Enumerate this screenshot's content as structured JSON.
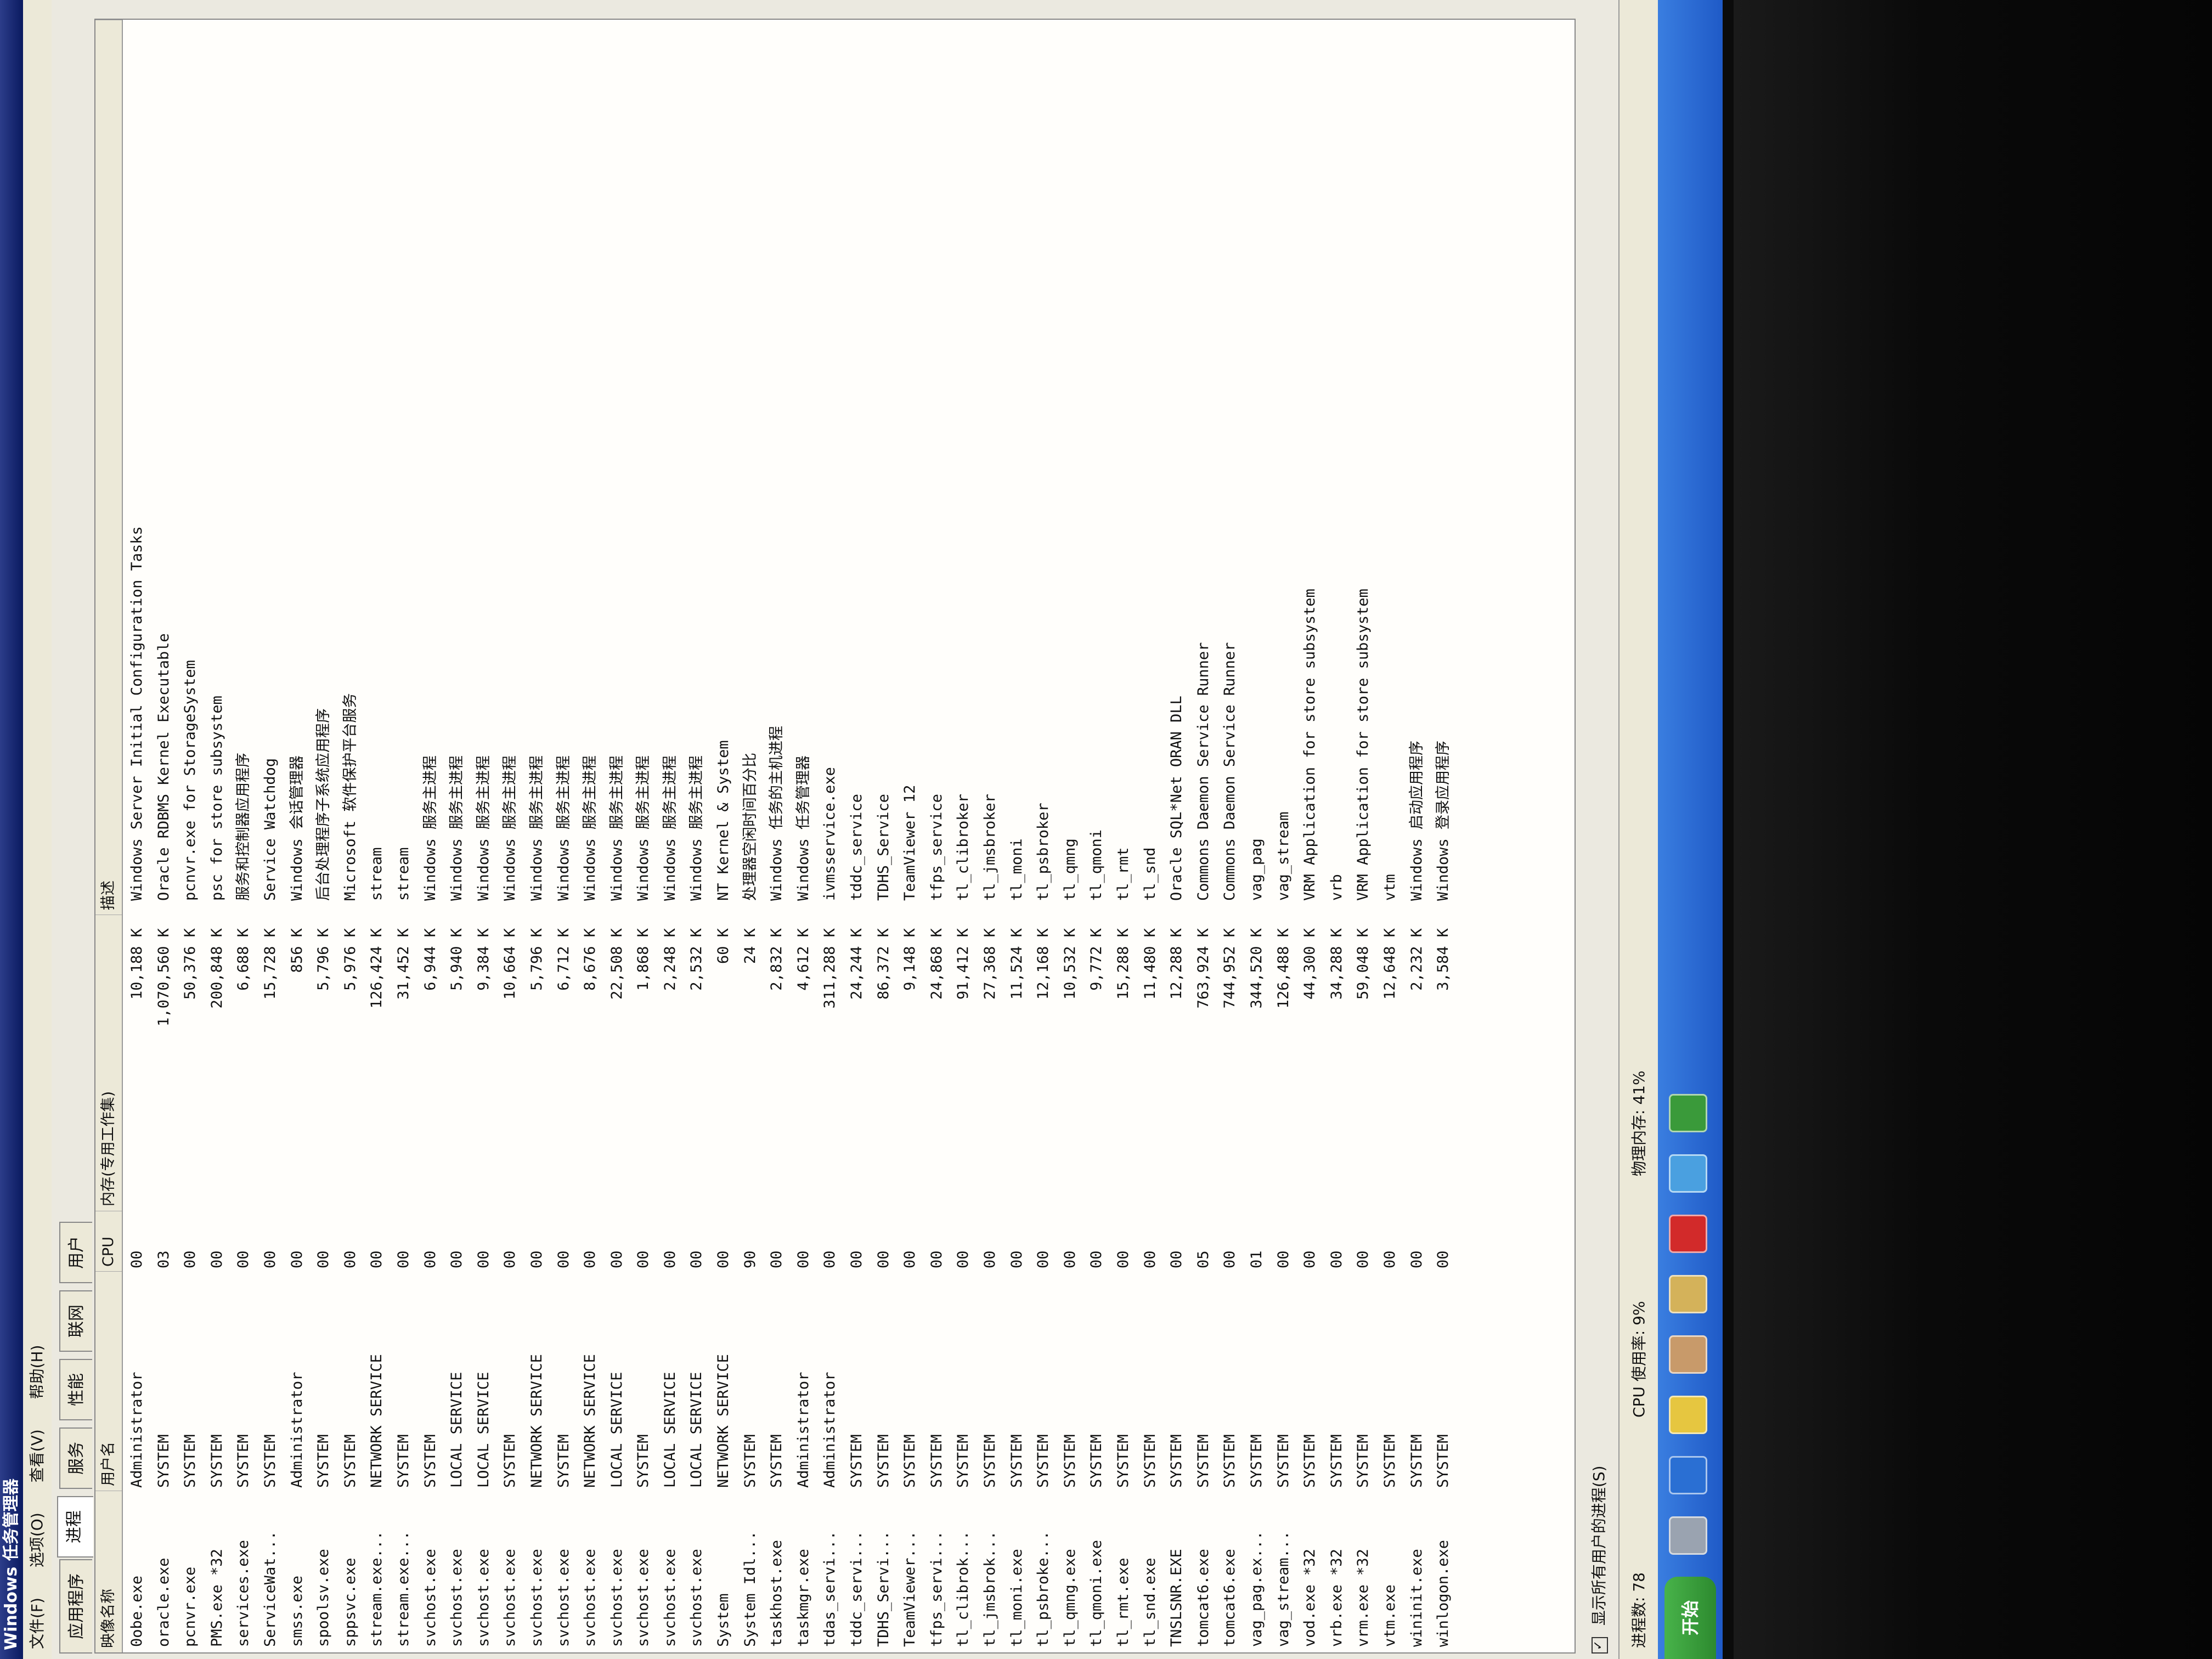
{
  "window": {
    "title": "Windows 任务管理器",
    "menu": [
      "文件(F)",
      "选项(O)",
      "查看(V)",
      "帮助(H)"
    ],
    "tabs": [
      "应用程序",
      "进程",
      "服务",
      "性能",
      "联网",
      "用户"
    ],
    "active_tab": "进程"
  },
  "columns": {
    "name": "映像名称",
    "user": "用户名",
    "cpu": "CPU",
    "mem": "内存(专用工作集)",
    "desc": "描述"
  },
  "processes": [
    {
      "name": "0obe.exe",
      "user": "Administrator",
      "cpu": "00",
      "mem": "10,188 K",
      "desc": "Windows Server Initial Configuration Tasks"
    },
    {
      "name": "oracle.exe",
      "user": "SYSTEM",
      "cpu": "03",
      "mem": "1,070,560 K",
      "desc": "Oracle RDBMS Kernel Executable"
    },
    {
      "name": "pcnvr.exe",
      "user": "SYSTEM",
      "cpu": "00",
      "mem": "50,376 K",
      "desc": "pcnvr.exe for StorageSystem"
    },
    {
      "name": "PMS.exe *32",
      "user": "SYSTEM",
      "cpu": "00",
      "mem": "200,848 K",
      "desc": "psc for store subsystem"
    },
    {
      "name": "services.exe",
      "user": "SYSTEM",
      "cpu": "00",
      "mem": "6,688 K",
      "desc": "服务和控制器应用程序"
    },
    {
      "name": "ServiceWat...",
      "user": "SYSTEM",
      "cpu": "00",
      "mem": "15,728 K",
      "desc": "Service Watchdog"
    },
    {
      "name": "smss.exe",
      "user": "Administrator",
      "cpu": "00",
      "mem": "856 K",
      "desc": "Windows 会话管理器"
    },
    {
      "name": "spoolsv.exe",
      "user": "SYSTEM",
      "cpu": "00",
      "mem": "5,796 K",
      "desc": "后台处理程序子系统应用程序"
    },
    {
      "name": "sppsvc.exe",
      "user": "SYSTEM",
      "cpu": "00",
      "mem": "5,976 K",
      "desc": "Microsoft 软件保护平台服务"
    },
    {
      "name": "stream.exe...",
      "user": "NETWORK SERVICE",
      "cpu": "00",
      "mem": "126,424 K",
      "desc": "stream"
    },
    {
      "name": "stream.exe...",
      "user": "SYSTEM",
      "cpu": "00",
      "mem": "31,452 K",
      "desc": "stream"
    },
    {
      "name": "svchost.exe",
      "user": "SYSTEM",
      "cpu": "00",
      "mem": "6,944 K",
      "desc": "Windows 服务主进程"
    },
    {
      "name": "svchost.exe",
      "user": "LOCAL SERVICE",
      "cpu": "00",
      "mem": "5,940 K",
      "desc": "Windows 服务主进程"
    },
    {
      "name": "svchost.exe",
      "user": "LOCAL SERVICE",
      "cpu": "00",
      "mem": "9,384 K",
      "desc": "Windows 服务主进程"
    },
    {
      "name": "svchost.exe",
      "user": "SYSTEM",
      "cpu": "00",
      "mem": "10,664 K",
      "desc": "Windows 服务主进程"
    },
    {
      "name": "svchost.exe",
      "user": "NETWORK SERVICE",
      "cpu": "00",
      "mem": "5,796 K",
      "desc": "Windows 服务主进程"
    },
    {
      "name": "svchost.exe",
      "user": "SYSTEM",
      "cpu": "00",
      "mem": "6,712 K",
      "desc": "Windows 服务主进程"
    },
    {
      "name": "svchost.exe",
      "user": "NETWORK SERVICE",
      "cpu": "00",
      "mem": "8,676 K",
      "desc": "Windows 服务主进程"
    },
    {
      "name": "svchost.exe",
      "user": "LOCAL SERVICE",
      "cpu": "00",
      "mem": "22,508 K",
      "desc": "Windows 服务主进程"
    },
    {
      "name": "svchost.exe",
      "user": "SYSTEM",
      "cpu": "00",
      "mem": "1,868 K",
      "desc": "Windows 服务主进程"
    },
    {
      "name": "svchost.exe",
      "user": "LOCAL SERVICE",
      "cpu": "00",
      "mem": "2,248 K",
      "desc": "Windows 服务主进程"
    },
    {
      "name": "svchost.exe",
      "user": "LOCAL SERVICE",
      "cpu": "00",
      "mem": "2,532 K",
      "desc": "Windows 服务主进程"
    },
    {
      "name": "System",
      "user": "NETWORK SERVICE",
      "cpu": "00",
      "mem": "60 K",
      "desc": "NT Kernel & System"
    },
    {
      "name": "System Idl...",
      "user": "SYSTEM",
      "cpu": "90",
      "mem": "24 K",
      "desc": "处理器空闲时间百分比"
    },
    {
      "name": "taskhost.exe",
      "user": "SYSTEM",
      "cpu": "00",
      "mem": "2,832 K",
      "desc": "Windows 任务的主机进程"
    },
    {
      "name": "taskmgr.exe",
      "user": "Administrator",
      "cpu": "00",
      "mem": "4,612 K",
      "desc": "Windows 任务管理器"
    },
    {
      "name": "tdas_servi...",
      "user": "Administrator",
      "cpu": "00",
      "mem": "311,288 K",
      "desc": "ivmsservice.exe"
    },
    {
      "name": "tddc_servi...",
      "user": "SYSTEM",
      "cpu": "00",
      "mem": "24,244 K",
      "desc": "tddc_service"
    },
    {
      "name": "TDHS_Servi...",
      "user": "SYSTEM",
      "cpu": "00",
      "mem": "86,372 K",
      "desc": "TDHS_Service"
    },
    {
      "name": "TeamViewer...",
      "user": "SYSTEM",
      "cpu": "00",
      "mem": "9,148 K",
      "desc": "TeamViewer 12"
    },
    {
      "name": "tfps_servi...",
      "user": "SYSTEM",
      "cpu": "00",
      "mem": "24,868 K",
      "desc": "tfps_service"
    },
    {
      "name": "tl_clibrok...",
      "user": "SYSTEM",
      "cpu": "00",
      "mem": "91,412 K",
      "desc": "tl_clibroker"
    },
    {
      "name": "tl_jmsbrok...",
      "user": "SYSTEM",
      "cpu": "00",
      "mem": "27,368 K",
      "desc": "tl_jmsbroker"
    },
    {
      "name": "tl_moni.exe",
      "user": "SYSTEM",
      "cpu": "00",
      "mem": "11,524 K",
      "desc": "tl_moni"
    },
    {
      "name": "tl_psbroke...",
      "user": "SYSTEM",
      "cpu": "00",
      "mem": "12,168 K",
      "desc": "tl_psbroker"
    },
    {
      "name": "tl_qmng.exe",
      "user": "SYSTEM",
      "cpu": "00",
      "mem": "10,532 K",
      "desc": "tl_qmng"
    },
    {
      "name": "tl_qmoni.exe",
      "user": "SYSTEM",
      "cpu": "00",
      "mem": "9,772 K",
      "desc": "tl_qmoni"
    },
    {
      "name": "tl_rmt.exe",
      "user": "SYSTEM",
      "cpu": "00",
      "mem": "15,288 K",
      "desc": "tl_rmt"
    },
    {
      "name": "tl_snd.exe",
      "user": "SYSTEM",
      "cpu": "00",
      "mem": "11,480 K",
      "desc": "tl_snd"
    },
    {
      "name": "TNSLSNR.EXE",
      "user": "SYSTEM",
      "cpu": "00",
      "mem": "12,288 K",
      "desc": "Oracle SQL*Net ORAN DLL"
    },
    {
      "name": "tomcat6.exe",
      "user": "SYSTEM",
      "cpu": "05",
      "mem": "763,924 K",
      "desc": "Commons Daemon Service Runner"
    },
    {
      "name": "tomcat6.exe",
      "user": "SYSTEM",
      "cpu": "00",
      "mem": "744,952 K",
      "desc": "Commons Daemon Service Runner"
    },
    {
      "name": "vag_pag.ex...",
      "user": "SYSTEM",
      "cpu": "01",
      "mem": "344,520 K",
      "desc": "vag_pag"
    },
    {
      "name": "vag_stream...",
      "user": "SYSTEM",
      "cpu": "00",
      "mem": "126,488 K",
      "desc": "vag_stream"
    },
    {
      "name": "vod.exe *32",
      "user": "SYSTEM",
      "cpu": "00",
      "mem": "44,300 K",
      "desc": "VRM Application for store subsystem"
    },
    {
      "name": "vrb.exe *32",
      "user": "SYSTEM",
      "cpu": "00",
      "mem": "34,288 K",
      "desc": "vrb"
    },
    {
      "name": "vrm.exe *32",
      "user": "SYSTEM",
      "cpu": "00",
      "mem": "59,048 K",
      "desc": "VRM Application for store subsystem"
    },
    {
      "name": "vtm.exe",
      "user": "SYSTEM",
      "cpu": "00",
      "mem": "12,648 K",
      "desc": "vtm"
    },
    {
      "name": "wininit.exe",
      "user": "SYSTEM",
      "cpu": "00",
      "mem": "2,232 K",
      "desc": "Windows 启动应用程序"
    },
    {
      "name": "winlogon.exe",
      "user": "SYSTEM",
      "cpu": "00",
      "mem": "3,584 K",
      "desc": "Windows 登录应用程序"
    }
  ],
  "footer": {
    "show_all_label": "显示所有用户的进程(S)",
    "show_all_checked": true
  },
  "status": {
    "processes": "进程数: 78",
    "cpu": "CPU 使用率: 9%",
    "memory": "物理内存: 41%"
  },
  "taskbar": {
    "start_label": "开始"
  }
}
